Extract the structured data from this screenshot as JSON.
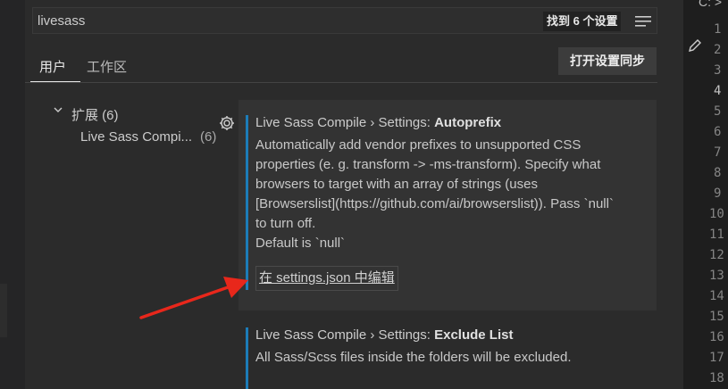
{
  "search": {
    "value": "livesass",
    "results_badge": "找到 6 个设置"
  },
  "tabs": [
    {
      "label": "用户",
      "active": true
    },
    {
      "label": "工作区",
      "active": false
    }
  ],
  "sync_button": "打开设置同步",
  "tree": {
    "extensions_label": "扩展 (6)",
    "item_label": "Live Sass Compi...",
    "item_count": "(6)"
  },
  "settings": [
    {
      "title_prefix": "Live Sass Compile › Settings: ",
      "title_name": "Autoprefix",
      "description": [
        "Automatically add vendor prefixes to unsupported CSS",
        "properties (e. g. transform -> -ms-transform). Specify what",
        "browsers to target with an array of strings (uses",
        "[Browserslist](https://github.com/ai/browserslist)). Pass `null`",
        "to turn off.",
        "Default is `null`"
      ],
      "edit_link": "在 settings.json 中编辑"
    },
    {
      "title_prefix": "Live Sass Compile › Settings: ",
      "title_name": "Exclude List",
      "description": [
        "All Sass/Scss files inside the folders will be excluded."
      ]
    }
  ],
  "editor": {
    "tab_label": "C: >",
    "line_numbers": [
      "1",
      "2",
      "3",
      "4",
      "5",
      "6",
      "7",
      "8",
      "9",
      "10",
      "11",
      "12",
      "13",
      "14",
      "15",
      "16",
      "17",
      "18"
    ]
  },
  "colors": {
    "accent_bar": "#1c7cb8",
    "arrow": "#e8271b"
  },
  "icons": [
    "filter-icon",
    "chevron-down-icon",
    "gear-icon",
    "pencil-icon",
    "annotation-arrow"
  ]
}
